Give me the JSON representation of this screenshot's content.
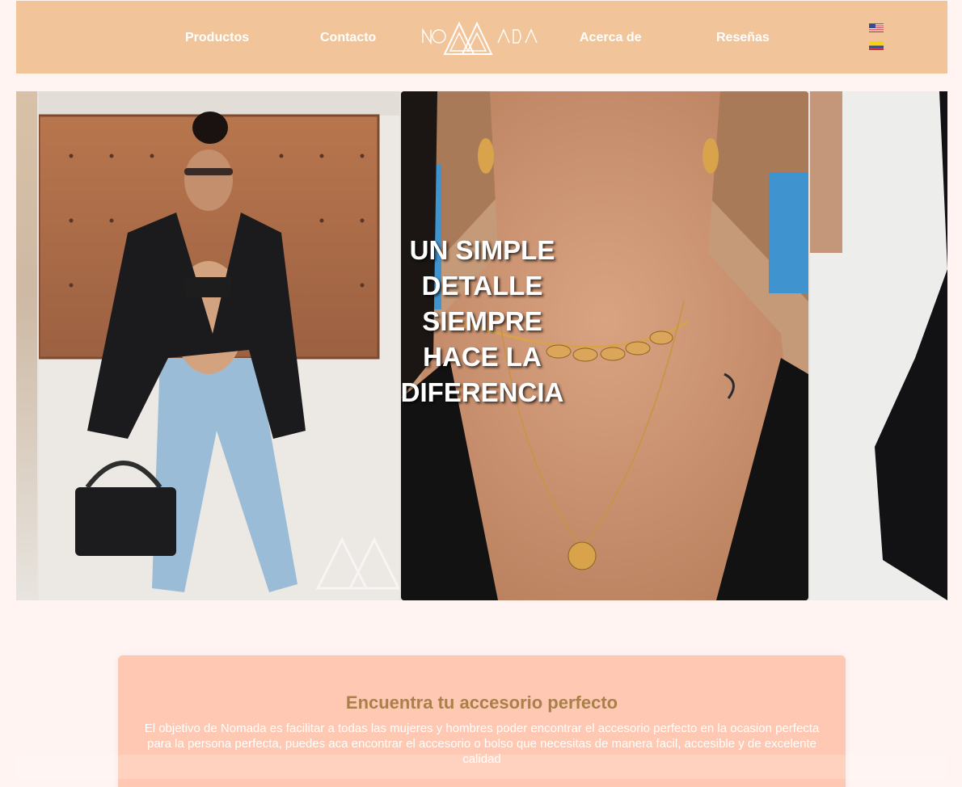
{
  "header": {
    "logo_alt": "NOMADA",
    "nav": {
      "productos": "Productos",
      "contacto": "Contacto",
      "acerca": "Acerca de",
      "resenas": "Reseñas"
    },
    "languages": [
      "en-us-flag",
      "es-co-flag"
    ]
  },
  "hero": {
    "text": "UN SIMPLE DETALLE SIEMPRE HACE LA DIFERENCIA"
  },
  "info": {
    "title": "Encuentra tu accesorio perfecto",
    "body": "El objetivo de Nomada es facilitar a todas las mujeres y hombres poder encontrar el accesorio perfecto en la ocasion perfecta para la persona perfecta, puedes aca encontrar el accesorio o bolso que necesitas de manera facil, accesible y de excelente calidad"
  },
  "colors": {
    "header_bg": "#f2c49a",
    "page_bg": "#fff4f2",
    "card_bg": "#ffc8b2",
    "title_color": "#a9804a"
  }
}
